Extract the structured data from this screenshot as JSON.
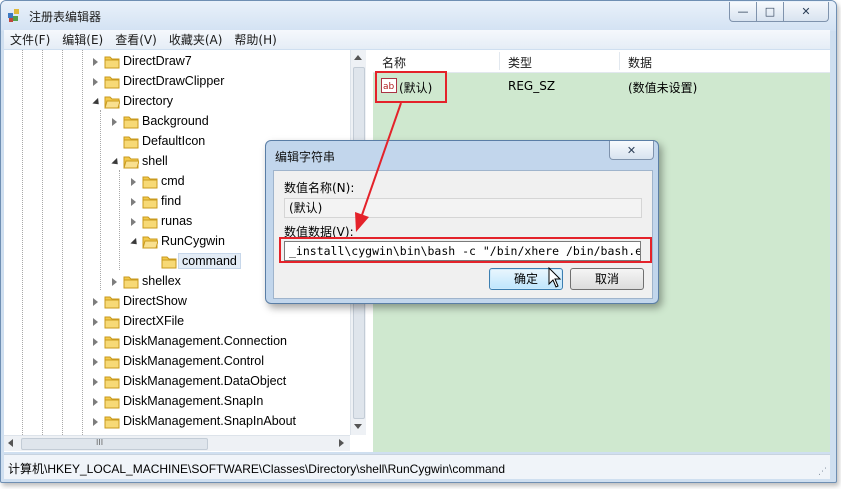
{
  "window": {
    "title": "注册表编辑器",
    "controls": {
      "minimize": "—",
      "maximize": "□",
      "close": "✕"
    }
  },
  "menu": [
    "文件(F)",
    "编辑(E)",
    "查看(V)",
    "收藏夹(A)",
    "帮助(H)"
  ],
  "tree": {
    "items": [
      {
        "label": "DirectDraw7",
        "state": "collapsed"
      },
      {
        "label": "DirectDrawClipper",
        "state": "collapsed"
      },
      {
        "label": "Directory",
        "state": "expanded"
      },
      {
        "label": "Background",
        "state": "collapsed"
      },
      {
        "label": "DefaultIcon",
        "state": "none"
      },
      {
        "label": "shell",
        "state": "expanded"
      },
      {
        "label": "cmd",
        "state": "collapsed"
      },
      {
        "label": "find",
        "state": "collapsed"
      },
      {
        "label": "runas",
        "state": "collapsed"
      },
      {
        "label": "RunCygwin",
        "state": "expanded"
      },
      {
        "label": "command",
        "state": "none",
        "selected": true
      },
      {
        "label": "shellex",
        "state": "collapsed"
      },
      {
        "label": "DirectShow",
        "state": "collapsed"
      },
      {
        "label": "DirectXFile",
        "state": "collapsed"
      },
      {
        "label": "DiskManagement.Connection",
        "state": "collapsed"
      },
      {
        "label": "DiskManagement.Control",
        "state": "collapsed"
      },
      {
        "label": "DiskManagement.DataObject",
        "state": "collapsed"
      },
      {
        "label": "DiskManagement.SnapIn",
        "state": "collapsed"
      },
      {
        "label": "DiskManagement.SnapInAbout",
        "state": "collapsed"
      }
    ],
    "hscroll_grip": "III"
  },
  "values": {
    "headers": {
      "name": "名称",
      "type": "类型",
      "data": "数据"
    },
    "rows": [
      {
        "icon": "ab",
        "name": "(默认)",
        "type": "REG_SZ",
        "data": "(数值未设置)"
      }
    ]
  },
  "status_path": "计算机\\HKEY_LOCAL_MACHINE\\SOFTWARE\\Classes\\Directory\\shell\\RunCygwin\\command",
  "dialog": {
    "title": "编辑字符串",
    "close": "✕",
    "name_label": "数值名称(N):",
    "name_value": "(默认)",
    "data_label": "数值数据(V):",
    "data_value": "_install\\cygwin\\bin\\bash -c \"/bin/xhere /bin/bash.exe '%L'\"",
    "ok": "确定",
    "cancel": "取消"
  },
  "colors": {
    "annotation": "#e4222a",
    "values_background": "#cfe8cf",
    "folder": "#f2c94c"
  }
}
